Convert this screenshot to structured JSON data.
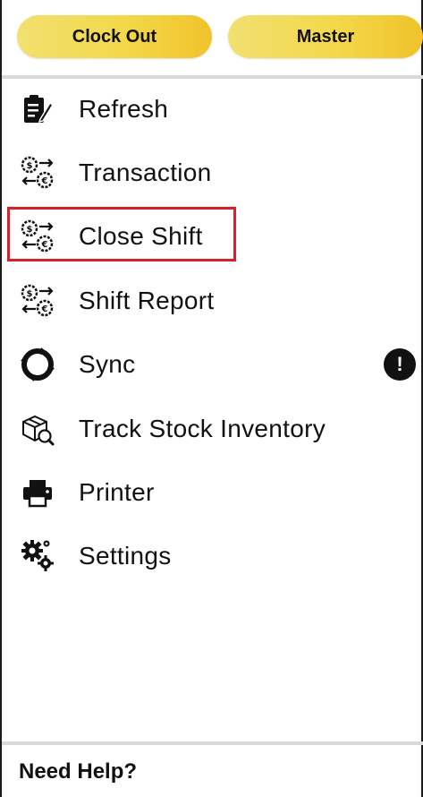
{
  "top_bar": {
    "clock_out_label": "Clock Out",
    "master_label": "Master"
  },
  "menu": {
    "items": [
      {
        "label": "Refresh",
        "icon": "clipboard-edit-icon"
      },
      {
        "label": "Transaction",
        "icon": "money-gears-icon"
      },
      {
        "label": "Close Shift",
        "icon": "money-gears-icon",
        "highlighted": true
      },
      {
        "label": "Shift Report",
        "icon": "money-gears-icon"
      },
      {
        "label": "Sync",
        "icon": "sync-icon",
        "badge": "!"
      },
      {
        "label": "Track Stock Inventory",
        "icon": "box-search-icon"
      },
      {
        "label": "Printer",
        "icon": "printer-icon"
      },
      {
        "label": "Settings",
        "icon": "gears-icon"
      }
    ]
  },
  "footer": {
    "help_label": "Need Help?"
  },
  "colors": {
    "pill_gradient_start": "#f2e070",
    "pill_gradient_end": "#f0c32a",
    "highlight_border": "#d8202a",
    "divider": "#d9d9d9"
  }
}
